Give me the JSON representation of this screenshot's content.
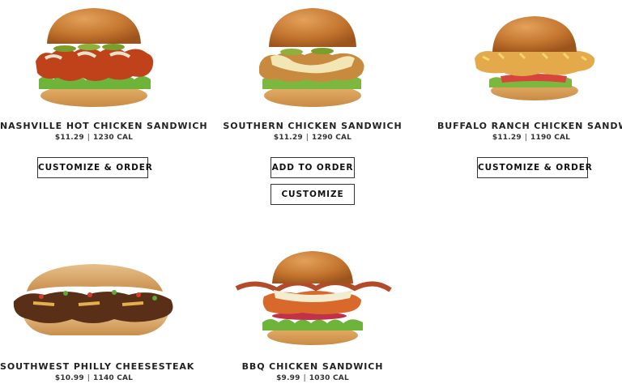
{
  "menu": {
    "items": [
      {
        "name": "NASHVILLE HOT CHICKEN SANDWICH",
        "price": "$11.29",
        "calories": "1230 CAL",
        "buttons": [
          "CUSTOMIZE & ORDER"
        ]
      },
      {
        "name": "SOUTHERN CHICKEN SANDWICH",
        "price": "$11.29",
        "calories": "1290 CAL",
        "buttons": [
          "ADD TO ORDER",
          "CUSTOMIZE"
        ]
      },
      {
        "name": "BUFFALO RANCH CHICKEN SANDWICH",
        "price": "$11.29",
        "calories": "1190 CAL",
        "buttons": [
          "CUSTOMIZE & ORDER"
        ]
      },
      {
        "name": "SOUTHWEST PHILLY CHEESESTEAK",
        "price": "$10.99",
        "calories": "1140 CAL",
        "buttons": []
      },
      {
        "name": "BBQ CHICKEN SANDWICH",
        "price": "$9.99",
        "calories": "1030 CAL",
        "buttons": []
      }
    ]
  },
  "separator": "|",
  "colors": {
    "text": "#222222",
    "button_border": "#333333",
    "background": "#ffffff"
  }
}
